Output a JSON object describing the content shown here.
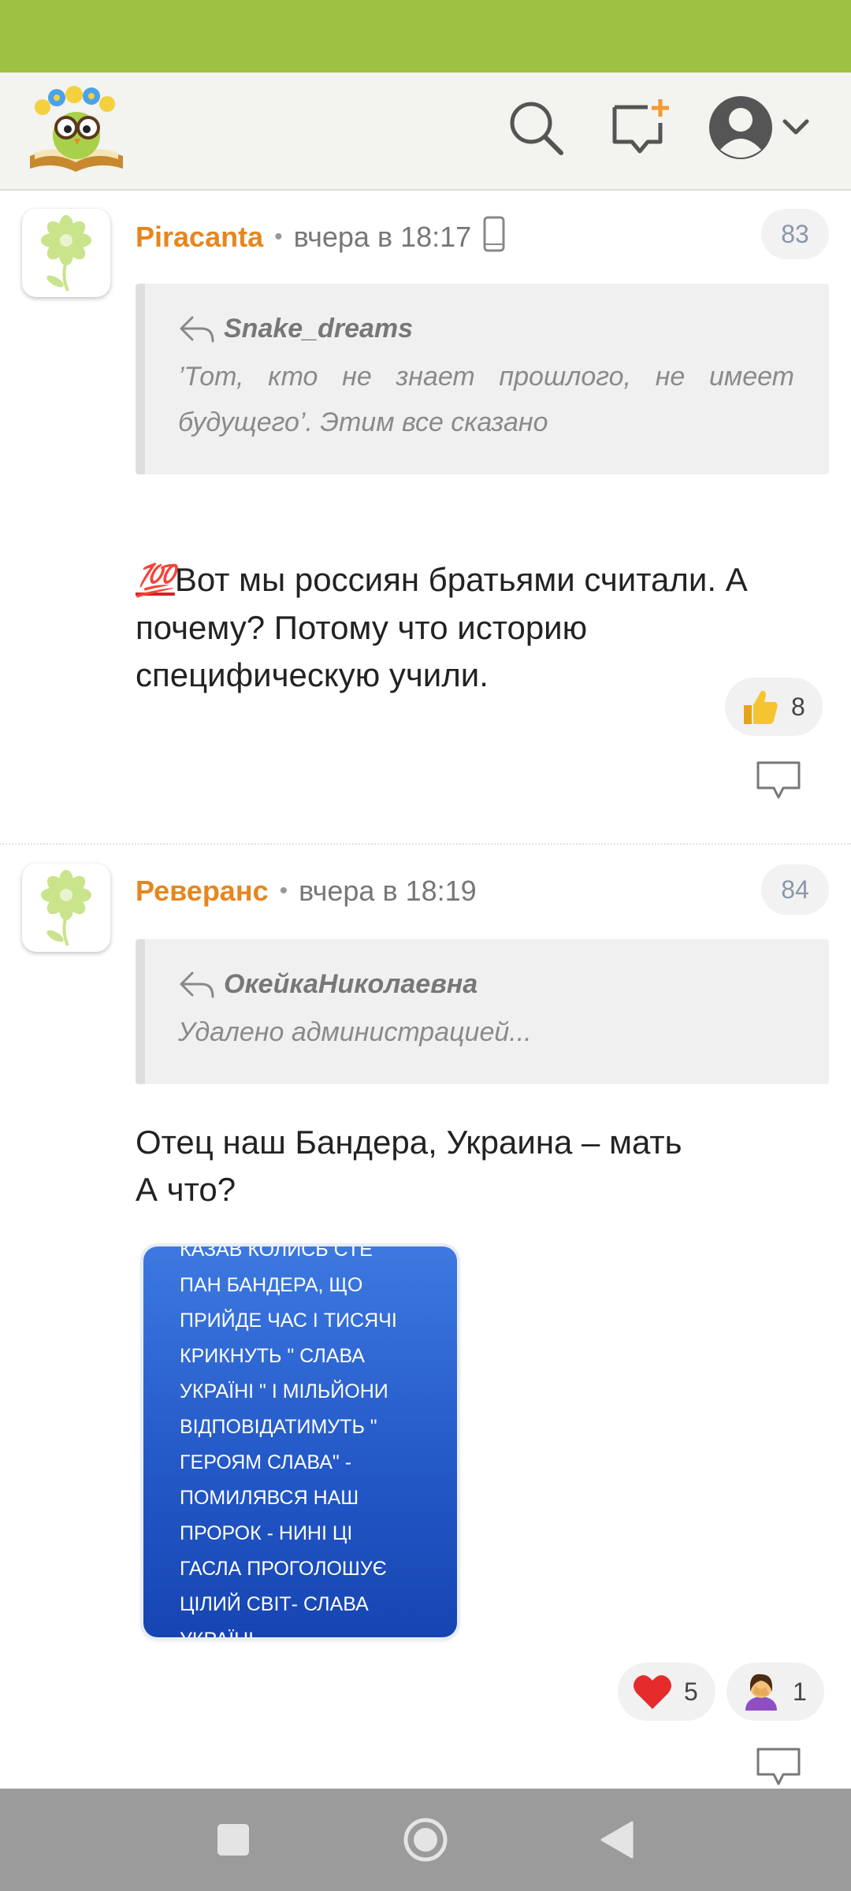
{
  "header": {
    "logo": "owl-book-logo",
    "icons": [
      "search-icon",
      "new-message-icon",
      "account-icon",
      "chevron-down-icon"
    ]
  },
  "comments": [
    {
      "author": "Piracanta",
      "time": "вчера в 18:17",
      "device": "mobile-phone-icon",
      "number": "83",
      "quote": {
        "author": "Snake_dreams",
        "text": "’Тот, кто не знает прошлого, не имеет будущего’. Этим все сказано"
      },
      "emoji": "💯",
      "text": "Вот мы россиян братьями считали. А почему? Потому что историю специфическую учили.",
      "reactions": [
        {
          "icon": "thumbs-up-icon",
          "count": "8"
        }
      ]
    },
    {
      "author": "Реверанс",
      "time": "вчера в 18:19",
      "number": "84",
      "quote": {
        "author": "ОкейкаНиколаевна",
        "text": "Удалено администрацией..."
      },
      "text": "Отец наш Бандера, Украина – мать\nА что?",
      "image_text": "КАЗАВ КОЛИСЬ СТЕ\nПАН БАНДЕРА, ЩО\nПРИЙДЕ ЧАС І ТИСЯЧІ\nКРИКНУТЬ \" СЛАВА\nУКРАЇНІ \" І МІЛЬЙОНИ\nВІДПОВІДАТИМУТЬ \"\nГЕРОЯМ СЛАВА\" -\nПОМИЛЯВСЯ НАШ\nПРОРОК - НИНІ ЦІ\nГАСЛА ПРОГОЛОШУЄ\nЦІЛИЙ СВІТ- СЛАВА\nУКРАЇНІ",
      "reactions": [
        {
          "icon": "heart-icon",
          "count": "5"
        },
        {
          "icon": "facepalm-icon",
          "count": "1"
        }
      ]
    }
  ],
  "navigation": [
    "recent-apps-icon",
    "home-icon",
    "back-icon"
  ],
  "colors": {
    "status_bar": "#9dc143",
    "author": "#e6861e",
    "accent_plus": "#f39a2e",
    "image_blue": "#2459c8"
  }
}
